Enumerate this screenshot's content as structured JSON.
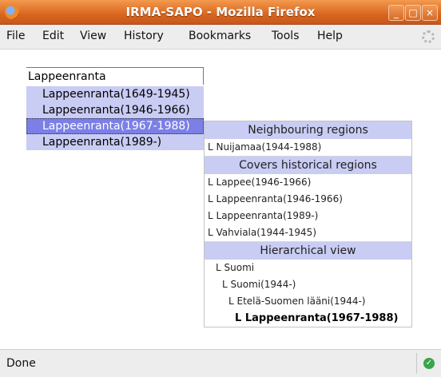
{
  "window": {
    "title": "IRMA-SAPO - Mozilla Firefox",
    "buttons": {
      "minimize": "_",
      "maximize": "□",
      "close": "×"
    }
  },
  "menu": {
    "items": [
      "File",
      "Edit",
      "View",
      "History",
      "Bookmarks",
      "Tools",
      "Help"
    ]
  },
  "search": {
    "value": "Lappeenranta",
    "suggestions": [
      "Lappeenranta(1649-1945)",
      "Lappeenranta(1946-1966)",
      "Lappeenranta(1967-1988)",
      "Lappeenranta(1989-)"
    ],
    "selected_index": 2
  },
  "details": {
    "neighbouring_header": "Neighbouring regions",
    "neighbouring": [
      "Nuijamaa(1944-1988)"
    ],
    "covers_header": "Covers historical regions",
    "covers": [
      "Lappee(1946-1966)",
      "Lappeenranta(1946-1966)",
      "Lappeenranta(1989-)",
      "Vahviala(1944-1945)"
    ],
    "hierarchy_header": "Hierarchical view",
    "hierarchy": [
      "Suomi",
      "Suomi(1944-)",
      "Etelä-Suomen lääni(1944-)",
      "Lappeenranta(1967-1988)"
    ],
    "branch_glyph": "L"
  },
  "status": {
    "text": "Done",
    "icon": "check-icon"
  },
  "colors": {
    "titlebar": "#d9661f",
    "suggest_bg": "#c9ccf3",
    "selected_bg": "#7b7fe6",
    "status_ok": "#3aa54a"
  }
}
